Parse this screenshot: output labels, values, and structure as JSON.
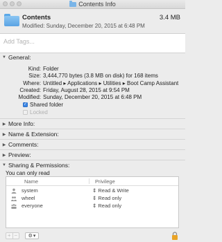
{
  "window": {
    "title": "Contents Info"
  },
  "header": {
    "name": "Contents",
    "size": "3.4 MB",
    "modified": "Modified: Sunday, December 20, 2015 at 6:48 PM"
  },
  "tags": {
    "placeholder": "Add Tags..."
  },
  "general": {
    "label": "General:",
    "rows": [
      {
        "key": "Kind:",
        "value": "Folder"
      },
      {
        "key": "Size:",
        "value": "3,444,770 bytes (3.8 MB on disk) for 168 items"
      },
      {
        "key": "Where:",
        "value": "Untitled ▸ Applications ▸ Utilities ▸ Boot Camp Assistant"
      },
      {
        "key": "Created:",
        "value": "Friday, August 28, 2015 at 9:54 PM"
      },
      {
        "key": "Modified:",
        "value": "Sunday, December 20, 2015 at 6:48 PM"
      }
    ],
    "shared_folder": {
      "label": "Shared folder",
      "checked": true
    },
    "locked": {
      "label": "Locked",
      "checked": false
    }
  },
  "sections": {
    "more_info": "More Info:",
    "name_extension": "Name & Extension:",
    "comments": "Comments:",
    "preview": "Preview:",
    "sharing": "Sharing & Permissions:"
  },
  "sharing": {
    "note": "You can only read",
    "columns": {
      "name": "Name",
      "privilege": "Privilege"
    },
    "rows": [
      {
        "name": "system",
        "privilege": "Read & Write",
        "icon": "user-icon"
      },
      {
        "name": "wheel",
        "privilege": "Read only",
        "icon": "group-icon"
      },
      {
        "name": "everyone",
        "privilege": "Read only",
        "icon": "everyone-icon"
      }
    ]
  },
  "bottom": {
    "add": "+",
    "remove": "−"
  },
  "colors": {
    "accent": "#3b86e4",
    "folder": "#5aa3e3",
    "lock": "#e9a326"
  }
}
